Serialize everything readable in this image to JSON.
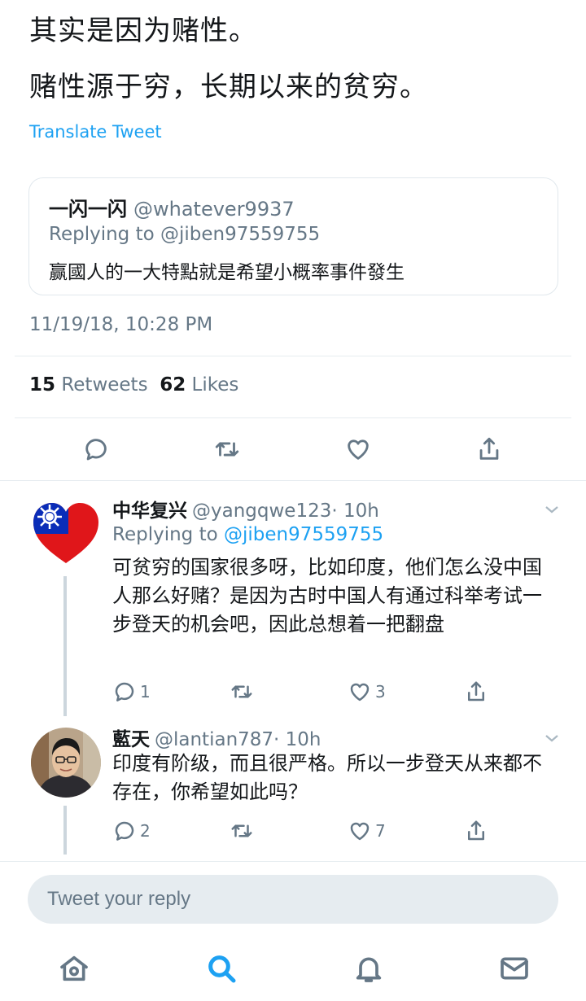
{
  "tweet": {
    "line1": "其实是因为赌性。",
    "line2": "赌性源于穷，长期以来的贫穷。",
    "translate_label": "Translate Tweet",
    "quote": {
      "name": "一闪一闪",
      "handle": "@whatever9937",
      "replying_to_prefix": "Replying to",
      "replying_to_handle": "@jiben97559755",
      "text": "赢國人的一大特點就是希望小概率事件發生"
    },
    "timestamp": "11/19/18, 10:28 PM",
    "retweets_count": "15",
    "retweets_label": "Retweets",
    "likes_count": "62",
    "likes_label": "Likes",
    "actions": {
      "reply_icon": "reply-icon",
      "retweet_icon": "retweet-icon",
      "like_icon": "heart-icon",
      "share_icon": "share-icon"
    }
  },
  "replies": [
    {
      "name": "中华复兴",
      "handle": "@yangqwe123",
      "time": "· 10h",
      "replying_to_prefix": "Replying to",
      "replying_to_handle": "@jiben97559755",
      "text": "可贫穷的国家很多呀，比如印度，他们怎么没中国人那么好赌？是因为古时中国人有通过科举考试一步登天的机会吧，因此总想着一把翻盘",
      "reply_count": "1",
      "retweet_count": "",
      "like_count": "3",
      "avatar_icon": "taiwan-flag-heart-avatar"
    },
    {
      "name": "藍天",
      "handle": "@lantian787",
      "time": "· 10h",
      "text": "印度有阶级，而且很严格。所以一步登天从来都不存在，你希望如此吗？",
      "reply_count": "2",
      "retweet_count": "",
      "like_count": "7",
      "avatar_icon": "user-photo-avatar"
    }
  ],
  "composer": {
    "placeholder": "Tweet your reply"
  },
  "tabbar": {
    "items": [
      "home-icon",
      "search-icon",
      "notifications-icon",
      "messages-icon"
    ],
    "active": "search-icon"
  },
  "colors": {
    "accent": "#1da1f2",
    "secondary_text": "#657786",
    "border": "#e6ecf0"
  }
}
